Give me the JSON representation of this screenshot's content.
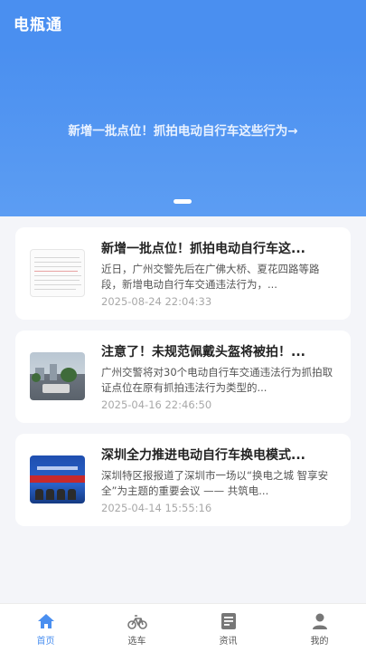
{
  "app": {
    "title": "电瓶通"
  },
  "banner": {
    "text": "新增一批点位！抓拍电动自行车这些行为→"
  },
  "news": [
    {
      "title": "新增一批点位！抓拍电动自行车这...",
      "summary": "近日，广州交警先后在广佛大桥、夏花四路等路段，新增电动自行车交通违法行为，...",
      "time": "2025-08-24 22:04:33",
      "thumbnail": "document-table-image"
    },
    {
      "title": "注意了！未规范佩戴头盔将被拍！...",
      "summary": "广州交警将对30个电动自行车交通违法行为抓拍取证点位在原有抓拍违法行为类型的...",
      "time": "2025-04-16 22:46:50",
      "thumbnail": "street-scene-image"
    },
    {
      "title": "深圳全力推进电动自行车换电模式...",
      "summary": "深圳特区报报道了深圳市一场以“换电之城 智享安全”为主题的重要会议 —— 共筑电...",
      "time": "2025-04-14 15:55:16",
      "thumbnail": "conference-stage-image"
    }
  ],
  "tabs": [
    {
      "label": "首页",
      "icon": "home-icon",
      "active": true
    },
    {
      "label": "选车",
      "icon": "bicycle-icon",
      "active": false
    },
    {
      "label": "资讯",
      "icon": "news-icon",
      "active": false
    },
    {
      "label": "我的",
      "icon": "user-icon",
      "active": false
    }
  ],
  "colors": {
    "primary": "#4a8ff0",
    "background": "#f4f5f9",
    "inactive": "#777777"
  }
}
